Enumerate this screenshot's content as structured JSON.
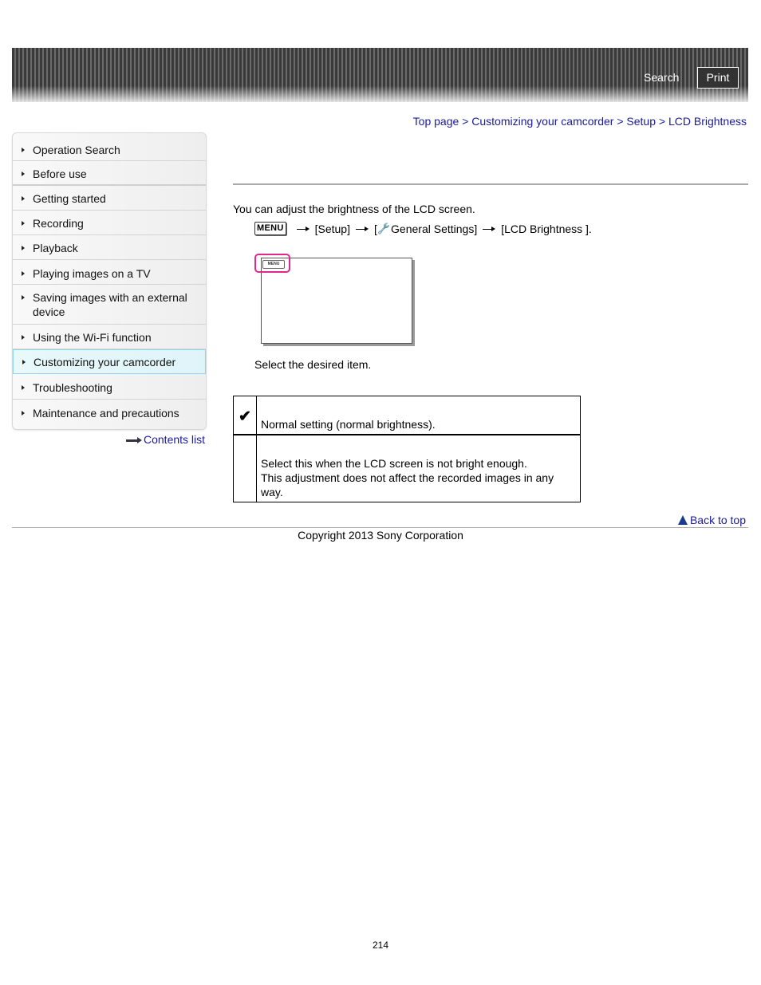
{
  "header": {
    "search_label": "Search",
    "print_label": "Print"
  },
  "breadcrumb": {
    "items": [
      "Top page",
      "Customizing your camcorder",
      "Setup",
      "LCD Brightness"
    ],
    "separator": ">"
  },
  "sidebar": {
    "items": [
      {
        "label": "Operation Search",
        "active": false
      },
      {
        "label": "Before use",
        "active": false
      },
      {
        "label": "Getting started",
        "active": false
      },
      {
        "label": "Recording",
        "active": false
      },
      {
        "label": "Playback",
        "active": false
      },
      {
        "label": "Playing images on a TV",
        "active": false
      },
      {
        "label": "Saving images with an external device",
        "active": false
      },
      {
        "label": "Using the Wi-Fi function",
        "active": false
      },
      {
        "label": "Customizing your camcorder",
        "active": true
      },
      {
        "label": "Troubleshooting",
        "active": false
      },
      {
        "label": "Maintenance and precautions",
        "active": false
      }
    ],
    "contents_list_label": "Contents list"
  },
  "main": {
    "intro": "You can adjust the brightness of the LCD screen.",
    "path": {
      "menu_key": "MENU",
      "step1": "[Setup]",
      "step2_prefix": "[",
      "step2_icon": "wrench-icon",
      "step2": "General Settings]",
      "step3": "[LCD Brightness ]."
    },
    "figure": {
      "menu_button_label": "MENU",
      "highlight_color": "#e0288a"
    },
    "select_text": "Select the desired item.",
    "options": [
      {
        "icon": "checkmark-icon",
        "selected": true,
        "lines": [
          "Normal setting (normal brightness)."
        ]
      },
      {
        "icon": "",
        "selected": false,
        "lines": [
          "Select this when the LCD screen is not bright enough.",
          "This adjustment does not affect the recorded images in any way."
        ]
      }
    ]
  },
  "footer": {
    "back_to_top": "Back to top",
    "copyright": "Copyright 2013 Sony Corporation",
    "page_number": "214"
  },
  "colors": {
    "link": "#1a1a9a",
    "active_border": "#8fd6ea"
  }
}
